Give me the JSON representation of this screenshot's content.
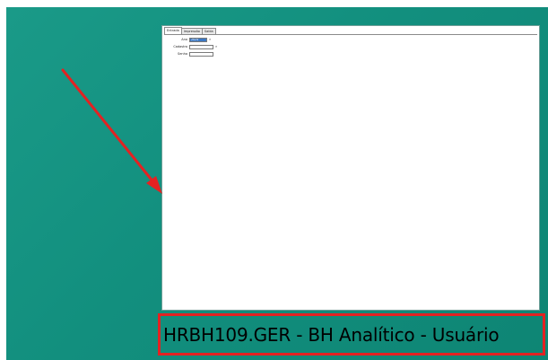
{
  "window": {
    "tabs": [
      {
        "label": "Entrada",
        "active": true
      },
      {
        "label": "Impressão",
        "active": false
      },
      {
        "label": "Saída",
        "active": false
      }
    ],
    "fields": [
      {
        "label": "Ano",
        "value": "2024",
        "selected": true,
        "has_lookup": true
      },
      {
        "label": "Cadastro",
        "value": "",
        "selected": false,
        "has_lookup": true
      },
      {
        "label": "Senha",
        "value": "",
        "selected": false,
        "has_lookup": false
      }
    ],
    "lookup_icon": "search-icon"
  },
  "caption": {
    "text": "HRBH109.GER - BH Analítico - Usuário"
  },
  "colors": {
    "desktop": "#128f7e",
    "annotation_red": "#e32222",
    "selection": "#3b78c4"
  }
}
